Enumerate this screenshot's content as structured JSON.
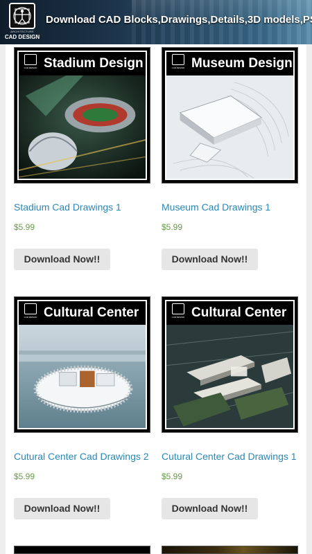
{
  "header": {
    "title": "Download CAD Blocks,Drawings,Details,3D models,PS",
    "logo_small_text": "ARCHITECTURE",
    "logo_brand": "CAD DESIGN"
  },
  "products": [
    {
      "thumb_title": "Stadium Design",
      "name": "Stadium Cad Drawings 1",
      "price": "$5.99",
      "button": "Download Now!!"
    },
    {
      "thumb_title": "Museum Design",
      "name": "Museum Cad Drawings 1",
      "price": "$5.99",
      "button": "Download Now!!"
    },
    {
      "thumb_title": "Cultural Center",
      "name": "Cutural Center Cad Drawings 2",
      "price": "$5.99",
      "button": "Download Now!!"
    },
    {
      "thumb_title": "Cultural Center",
      "name": "Cutural Center Cad Drawings 1",
      "price": "$5.99",
      "button": "Download Now!!"
    }
  ],
  "thumb_logo_text": "CAD DESIGN",
  "colors": {
    "link": "#2a87b5",
    "price": "#6a9a4a",
    "button_bg": "#e6e6e6"
  }
}
